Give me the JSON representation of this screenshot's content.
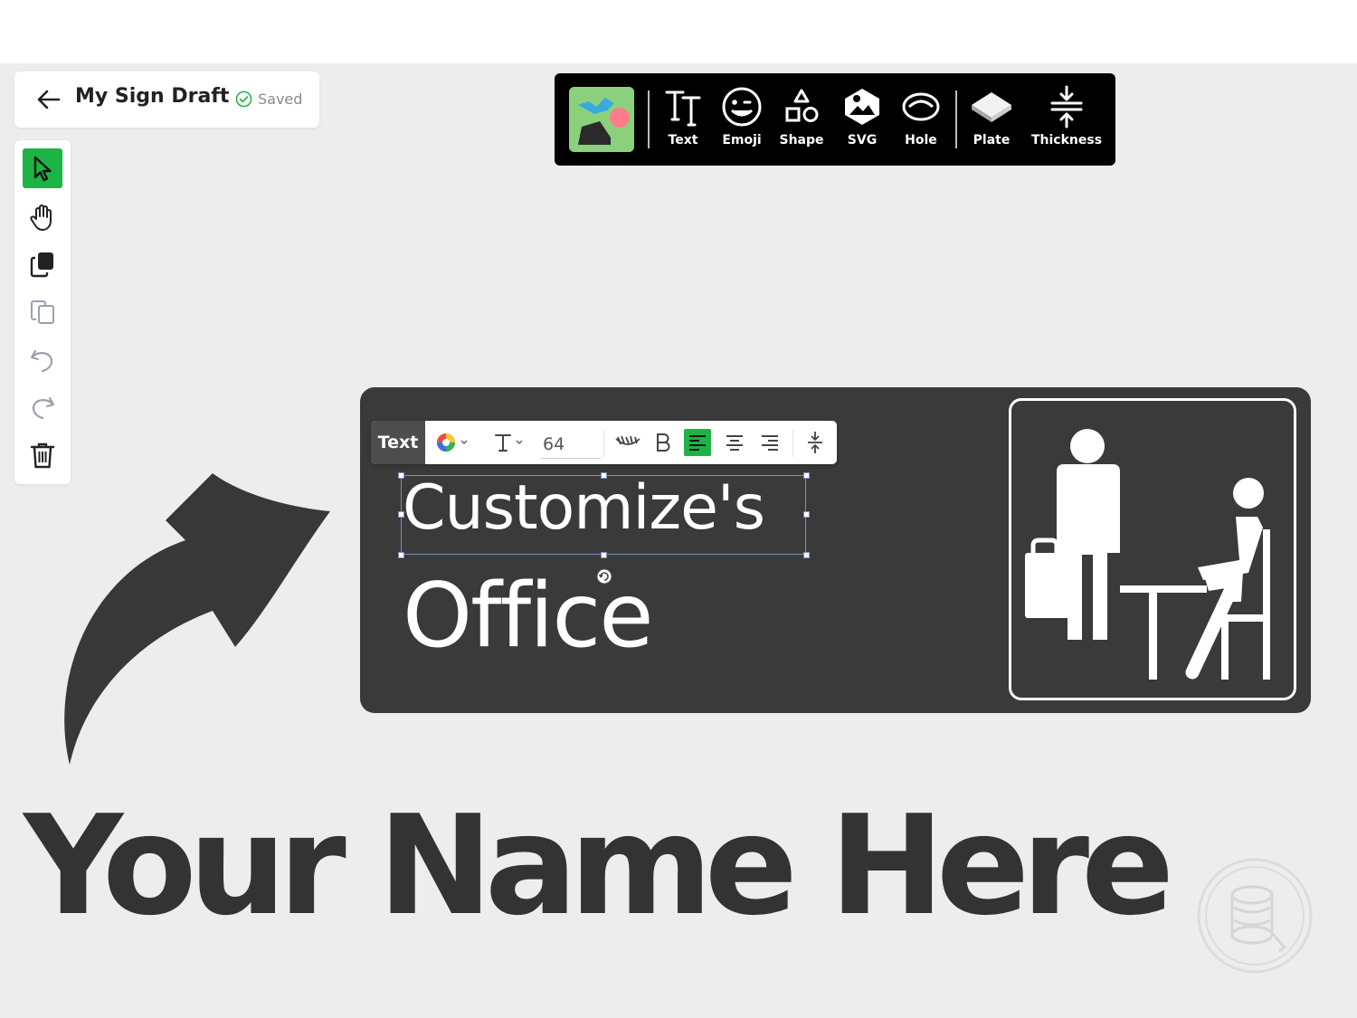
{
  "header": {
    "title": "My Sign Draft",
    "status": "Saved"
  },
  "tools": [
    "select-tool",
    "pan-tool",
    "duplicate-tool",
    "paste-tool",
    "undo-tool",
    "redo-tool",
    "delete-tool"
  ],
  "element_toolbar": {
    "items": [
      {
        "label": "Text",
        "icon": "text-icon"
      },
      {
        "label": "Emoji",
        "icon": "emoji-icon"
      },
      {
        "label": "Shape",
        "icon": "shape-icon"
      },
      {
        "label": "SVG",
        "icon": "svg-icon"
      },
      {
        "label": "Hole",
        "icon": "hole-icon"
      },
      {
        "label": "Plate",
        "icon": "plate-icon"
      },
      {
        "label": "Thickness",
        "icon": "thickness-icon"
      }
    ]
  },
  "text_toolbar": {
    "tag": "Text",
    "font_size": "64"
  },
  "sign": {
    "line1": "Customize's",
    "line2": "Office",
    "background": "#3a3a3a",
    "text_color": "#ffffff"
  },
  "promo": {
    "text": "Your Name Here"
  },
  "colors": {
    "accent": "#1db446",
    "toolbar_bg": "#000000",
    "canvas_bg": "#ededed"
  }
}
